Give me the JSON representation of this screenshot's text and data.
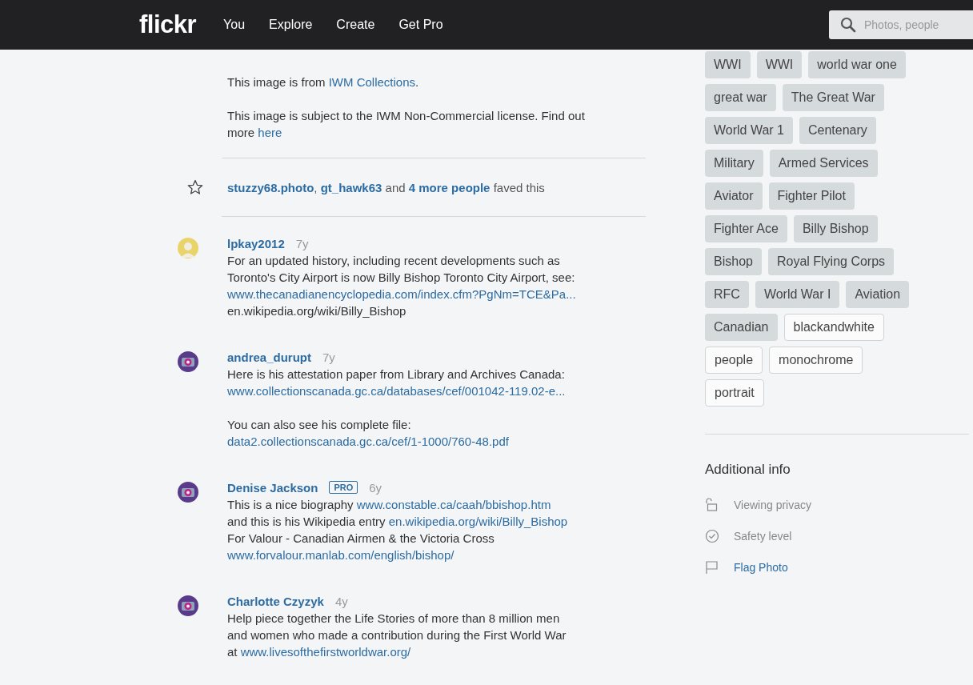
{
  "header": {
    "logo": "flickr",
    "nav": [
      {
        "label": "You"
      },
      {
        "label": "Explore"
      },
      {
        "label": "Create"
      },
      {
        "label": "Get Pro"
      }
    ],
    "search": {
      "placeholder": "Photos, people"
    }
  },
  "description": [
    [
      {
        "text": "This image is from ",
        "link": false
      },
      {
        "text": "IWM Collections",
        "link": true
      },
      {
        "text": ".",
        "link": false
      }
    ],
    [
      {
        "text": "This image is subject to the IWM Non-Commercial license. Find out more ",
        "link": false
      },
      {
        "text": "here",
        "link": true
      }
    ]
  ],
  "faves": [
    {
      "text": "stuzzy68.photo",
      "link": true
    },
    {
      "text": ", ",
      "link": false
    },
    {
      "text": "gt_hawk63",
      "link": true
    },
    {
      "text": " and ",
      "link": false
    },
    {
      "text": "4 more people",
      "link": true
    },
    {
      "text": " faved this",
      "link": false
    }
  ],
  "comments": [
    {
      "author": "lpkay2012",
      "age": "7y",
      "paragraphs": [
        [
          [
            {
              "text": "For an updated history, including recent developments such as",
              "link": false
            }
          ],
          [
            {
              "text": "Toronto's City Airport is now Billy Bishop Toronto City Airport, see:",
              "link": false
            }
          ],
          [
            {
              "text": "www.thecanadianencyclopedia.com/index.cfm?PgNm=TCE&Pa...",
              "link": true
            }
          ],
          [
            {
              "text": "en.wikipedia.org/wiki/Billy_Bishop",
              "link": false
            }
          ]
        ]
      ]
    },
    {
      "author": "andrea_durupt",
      "age": "7y",
      "paragraphs": [
        [
          [
            {
              "text": "Here is his attestation paper from Library and Archives Canada:",
              "link": false
            }
          ],
          [
            {
              "text": "www.collectionscanada.gc.ca/databases/cef/001042-119.02-e...",
              "link": true
            }
          ]
        ],
        [
          [
            {
              "text": "You can also see his complete file:",
              "link": false
            }
          ],
          [
            {
              "text": "data2.collectionscanada.gc.ca/cef/1-1000/760-48.pdf",
              "link": true
            }
          ]
        ]
      ]
    },
    {
      "author": "Denise Jackson",
      "badge": "PRO",
      "age": "6y",
      "paragraphs": [
        [
          [
            {
              "text": "This is a nice biography ",
              "link": false
            },
            {
              "text": "www.constable.ca/caah/bbishop.htm",
              "link": true
            }
          ],
          [
            {
              "text": "and this is his Wikipedia entry ",
              "link": false
            },
            {
              "text": "en.wikipedia.org/wiki/Billy_Bishop",
              "link": true
            }
          ],
          [
            {
              "text": "For Valour - Canadian Airmen & the Victoria Cross",
              "link": false
            }
          ],
          [
            {
              "text": "www.forvalour.manlab.com/english/bishop/",
              "link": true
            }
          ]
        ]
      ]
    },
    {
      "author": "Charlotte Czyzyk",
      "age": "4y",
      "paragraphs": [
        [
          [
            {
              "text": "Help piece together the Life Stories of more than 8 million men",
              "link": false
            }
          ],
          [
            {
              "text": "and women who made a contribution during the First World War",
              "link": false
            }
          ],
          [
            {
              "text": "at ",
              "link": false
            },
            {
              "text": "www.livesofthefirstworldwar.org/",
              "link": true
            }
          ]
        ]
      ]
    }
  ],
  "tags": [
    {
      "label": "WWI",
      "kind": "filled"
    },
    {
      "label": "WWI",
      "kind": "filled"
    },
    {
      "label": "world war one",
      "kind": "filled"
    },
    {
      "label": "great war",
      "kind": "filled"
    },
    {
      "label": "The Great War",
      "kind": "filled"
    },
    {
      "label": "World War 1",
      "kind": "filled"
    },
    {
      "label": "Centenary",
      "kind": "filled"
    },
    {
      "label": "Military",
      "kind": "filled"
    },
    {
      "label": "Armed Services",
      "kind": "filled"
    },
    {
      "label": "Aviator",
      "kind": "filled"
    },
    {
      "label": "Fighter Pilot",
      "kind": "filled"
    },
    {
      "label": "Fighter Ace",
      "kind": "filled"
    },
    {
      "label": "Billy Bishop",
      "kind": "filled"
    },
    {
      "label": "Bishop",
      "kind": "filled"
    },
    {
      "label": "Royal Flying Corps",
      "kind": "filled"
    },
    {
      "label": "RFC",
      "kind": "filled"
    },
    {
      "label": "World War I",
      "kind": "filled"
    },
    {
      "label": "Aviation",
      "kind": "filled"
    },
    {
      "label": "Canadian",
      "kind": "filled"
    },
    {
      "label": "blackandwhite",
      "kind": "outlined"
    },
    {
      "label": "people",
      "kind": "outlined"
    },
    {
      "label": "monochrome",
      "kind": "outlined"
    },
    {
      "label": "portrait",
      "kind": "outlined"
    }
  ],
  "additional_info": {
    "title": "Additional info",
    "items": [
      {
        "label": "Viewing privacy",
        "kind": "privacy"
      },
      {
        "label": "Safety level",
        "kind": "safety"
      },
      {
        "label": "Flag Photo",
        "kind": "flag"
      }
    ]
  }
}
